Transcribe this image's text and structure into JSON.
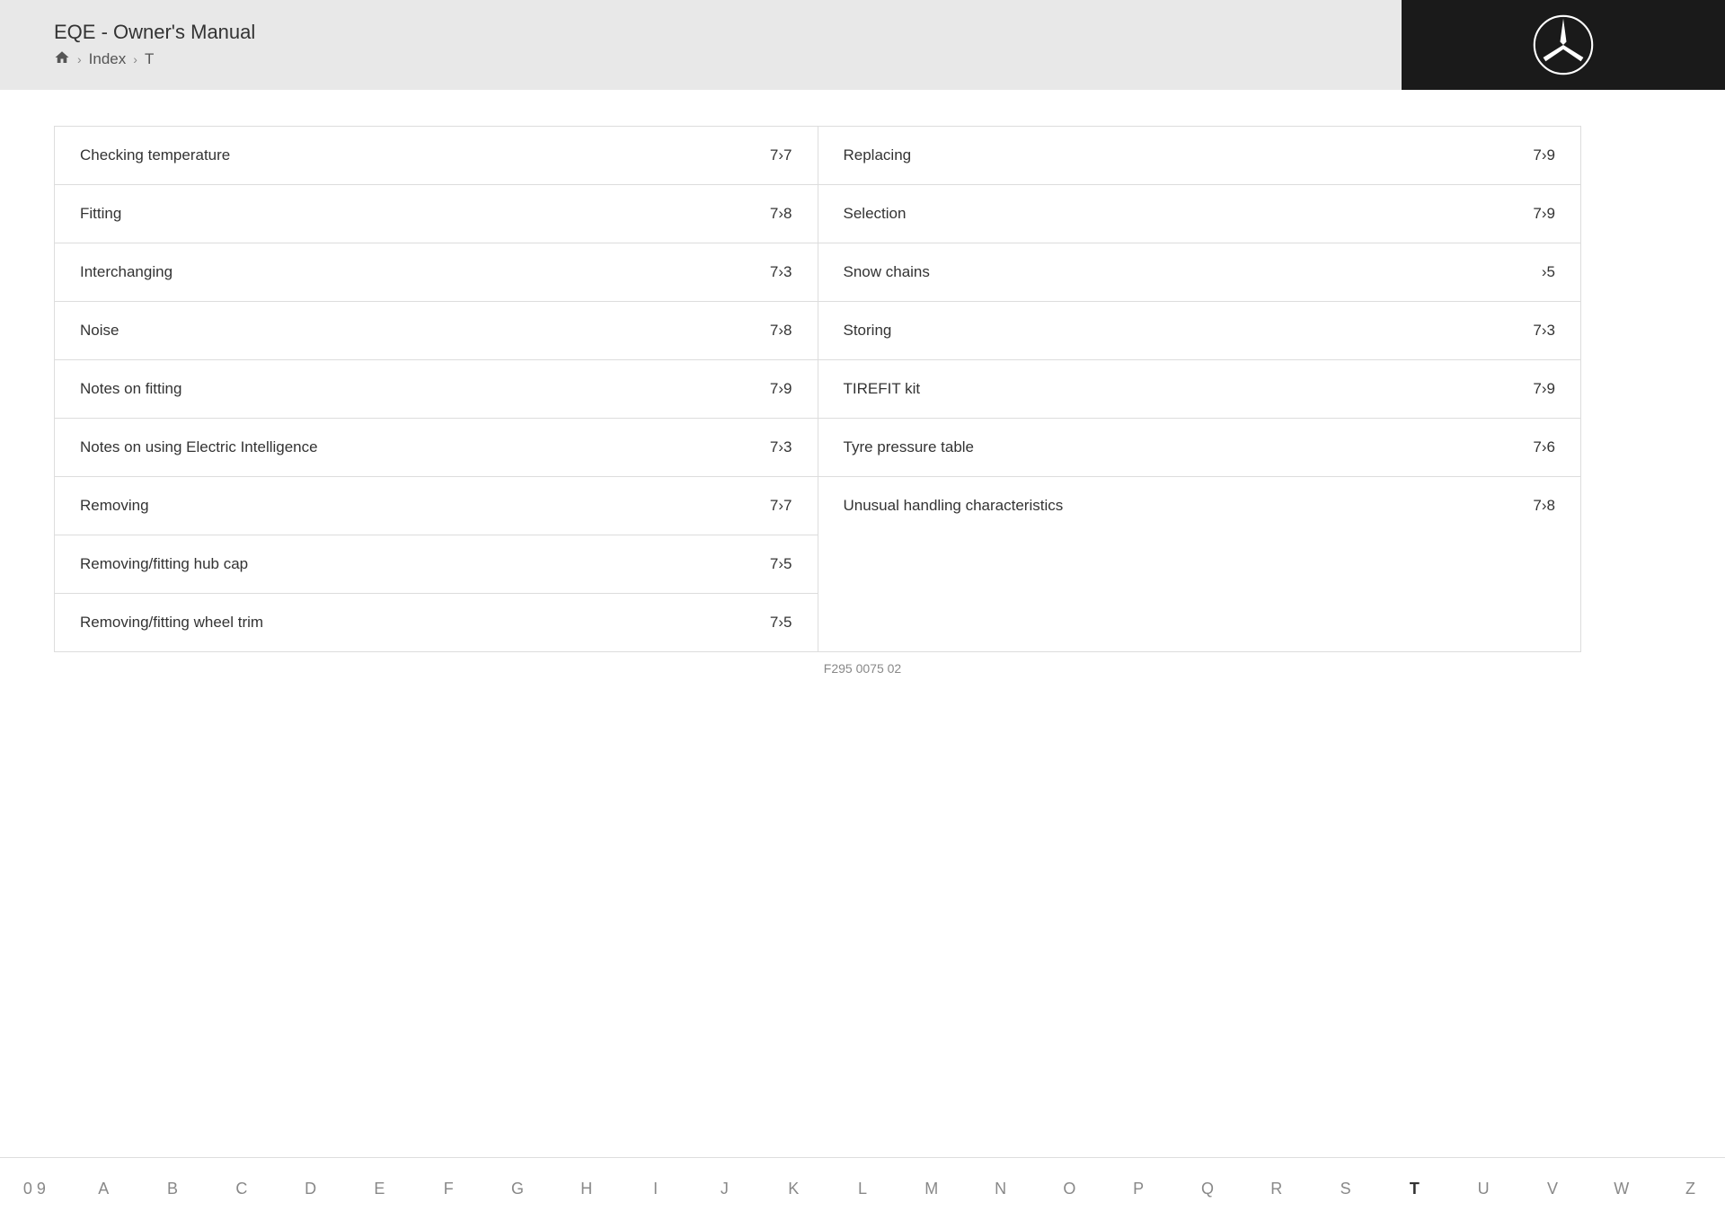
{
  "header": {
    "title": "EQE - Owner's Manual",
    "breadcrumb": {
      "home_label": "🏠",
      "sep1": ">",
      "index_label": "Index",
      "sep2": ">",
      "current": "T"
    }
  },
  "left_column": [
    {
      "label": "Checking temperature",
      "page": "7›7"
    },
    {
      "label": "Fitting",
      "page": "7›8"
    },
    {
      "label": "Interchanging",
      "page": "7›3"
    },
    {
      "label": "Noise",
      "page": "7›8"
    },
    {
      "label": "Notes on fitting",
      "page": "7›9"
    },
    {
      "label": "Notes on using Electric Intelligence",
      "page": "7›3"
    },
    {
      "label": "Removing",
      "page": "7›7"
    },
    {
      "label": "Removing/fitting hub cap",
      "page": "7›5"
    },
    {
      "label": "Removing/fitting wheel trim",
      "page": "7›5"
    }
  ],
  "right_column": [
    {
      "label": "Replacing",
      "page": "7›9"
    },
    {
      "label": "Selection",
      "page": "7›9"
    },
    {
      "label": "Snow chains",
      "page": "›5"
    },
    {
      "label": "Storing",
      "page": "7›3"
    },
    {
      "label": "TIREFIT kit",
      "page": "7›9"
    },
    {
      "label": "Tyre pressure table",
      "page": "7›6"
    },
    {
      "label": "Unusual handling characteristics",
      "page": "7›8"
    }
  ],
  "alpha_bar": {
    "items": [
      "0 9",
      "A",
      "B",
      "C",
      "D",
      "E",
      "F",
      "G",
      "H",
      "I",
      "J",
      "K",
      "L",
      "M",
      "N",
      "O",
      "P",
      "Q",
      "R",
      "S",
      "T",
      "U",
      "V",
      "W",
      "Z"
    ],
    "active": "T"
  },
  "footer": {
    "code": "F295 0075 02"
  }
}
